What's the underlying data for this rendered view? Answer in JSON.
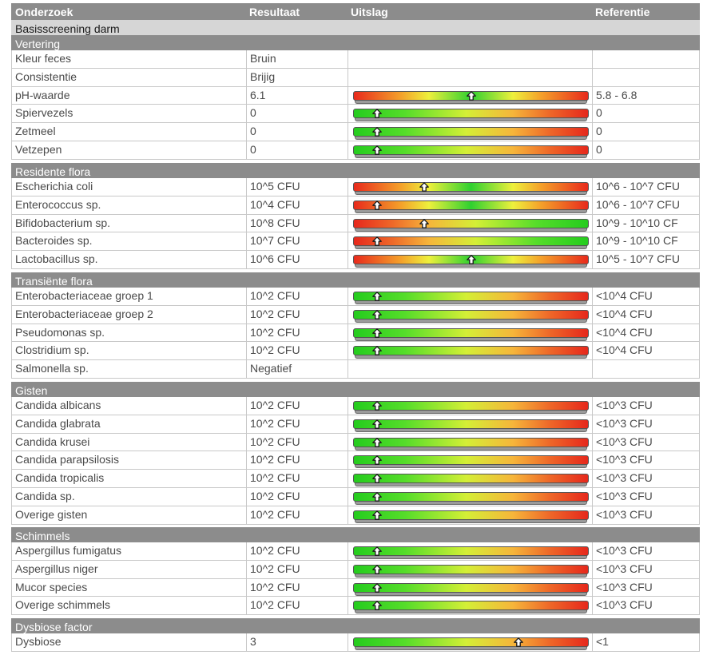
{
  "header": {
    "col_test": "Onderzoek",
    "col_result": "Resultaat",
    "col_outcome": "Uitslag",
    "col_reference": "Referentie"
  },
  "subtitle": "Basisscreening darm",
  "colors": {
    "header_bg": "#8c8c8c",
    "section_bg": "#8c8c8c",
    "subtitle_bg": "#d6d6d6",
    "gauge_red": "#e82a1c",
    "gauge_green": "#2fd030",
    "gauge_yellow": "#eef03c"
  },
  "sections": [
    {
      "name": "Vertering",
      "rows": [
        {
          "test": "Kleur feces",
          "result": "Bruin",
          "reference": "",
          "gauge": null
        },
        {
          "test": "Consistentie",
          "result": "Brijig",
          "reference": "",
          "gauge": null
        },
        {
          "test": "pH-waarde",
          "result": "6.1",
          "reference": "5.8 - 6.8",
          "gauge": "red-green-red",
          "marker": 0.5
        },
        {
          "test": "Spiervezels",
          "result": "0",
          "reference": "0",
          "gauge": "green-red",
          "marker": 0.1
        },
        {
          "test": "Zetmeel",
          "result": "0",
          "reference": "0",
          "gauge": "green-red",
          "marker": 0.1
        },
        {
          "test": "Vetzepen",
          "result": "0",
          "reference": "0",
          "gauge": "green-red",
          "marker": 0.1
        }
      ]
    },
    {
      "name": "Residente flora",
      "rows": [
        {
          "test": "Escherichia coli",
          "result": "10^5 CFU",
          "reference": "10^6 - 10^7 CFU",
          "gauge": "red-green-red",
          "marker": 0.3
        },
        {
          "test": "Enterococcus sp.",
          "result": "10^4 CFU",
          "reference": "10^6 - 10^7 CFU",
          "gauge": "red-green-red",
          "marker": 0.1
        },
        {
          "test": "Bifidobacterium sp.",
          "result": "10^8 CFU",
          "reference": "10^9 - 10^10 CF",
          "gauge": "red-green",
          "marker": 0.3
        },
        {
          "test": "Bacteroides sp.",
          "result": "10^7 CFU",
          "reference": "10^9 - 10^10 CF",
          "gauge": "red-green",
          "marker": 0.1
        },
        {
          "test": "Lactobacillus sp.",
          "result": "10^6 CFU",
          "reference": "10^5 - 10^7 CFU",
          "gauge": "red-green-red",
          "marker": 0.5
        }
      ]
    },
    {
      "name": "Transiënte flora",
      "rows": [
        {
          "test": "Enterobacteriaceae groep 1",
          "result": "10^2 CFU",
          "reference": "<10^4 CFU",
          "gauge": "green-red",
          "marker": 0.1
        },
        {
          "test": "Enterobacteriaceae groep 2",
          "result": "10^2 CFU",
          "reference": "<10^4 CFU",
          "gauge": "green-red",
          "marker": 0.1
        },
        {
          "test": "Pseudomonas sp.",
          "result": "10^2 CFU",
          "reference": "<10^4 CFU",
          "gauge": "green-red",
          "marker": 0.1
        },
        {
          "test": "Clostridium sp.",
          "result": "10^2 CFU",
          "reference": "<10^4 CFU",
          "gauge": "green-red",
          "marker": 0.1
        },
        {
          "test": "Salmonella sp.",
          "result": "Negatief",
          "reference": "",
          "gauge": null
        }
      ]
    },
    {
      "name": "Gisten",
      "rows": [
        {
          "test": "Candida albicans",
          "result": "10^2 CFU",
          "reference": "<10^3 CFU",
          "gauge": "green-red",
          "marker": 0.1
        },
        {
          "test": "Candida glabrata",
          "result": "10^2 CFU",
          "reference": "<10^3 CFU",
          "gauge": "green-red",
          "marker": 0.1
        },
        {
          "test": "Candida krusei",
          "result": "10^2 CFU",
          "reference": "<10^3 CFU",
          "gauge": "green-red",
          "marker": 0.1
        },
        {
          "test": "Candida parapsilosis",
          "result": "10^2 CFU",
          "reference": "<10^3 CFU",
          "gauge": "green-red",
          "marker": 0.1
        },
        {
          "test": "Candida tropicalis",
          "result": "10^2 CFU",
          "reference": "<10^3 CFU",
          "gauge": "green-red",
          "marker": 0.1
        },
        {
          "test": "Candida sp.",
          "result": "10^2 CFU",
          "reference": "<10^3 CFU",
          "gauge": "green-red",
          "marker": 0.1
        },
        {
          "test": "Overige gisten",
          "result": "10^2 CFU",
          "reference": "<10^3 CFU",
          "gauge": "green-red",
          "marker": 0.1
        }
      ]
    },
    {
      "name": "Schimmels",
      "rows": [
        {
          "test": "Aspergillus fumigatus",
          "result": "10^2 CFU",
          "reference": "<10^3 CFU",
          "gauge": "green-red",
          "marker": 0.1
        },
        {
          "test": "Aspergillus niger",
          "result": "10^2 CFU",
          "reference": "<10^3 CFU",
          "gauge": "green-red",
          "marker": 0.1
        },
        {
          "test": "Mucor species",
          "result": "10^2 CFU",
          "reference": "<10^3 CFU",
          "gauge": "green-red",
          "marker": 0.1
        },
        {
          "test": "Overige schimmels",
          "result": "10^2 CFU",
          "reference": "<10^3 CFU",
          "gauge": "green-red",
          "marker": 0.1
        }
      ]
    },
    {
      "name": "Dysbiose factor",
      "rows": [
        {
          "test": "Dysbiose",
          "result": "3",
          "reference": "<1",
          "gauge": "green-red",
          "marker": 0.7
        }
      ]
    }
  ]
}
